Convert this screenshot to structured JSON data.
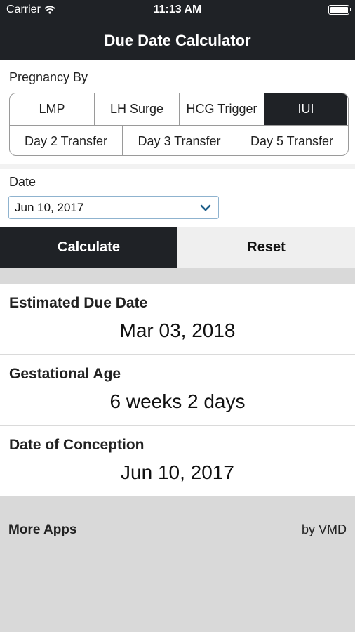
{
  "status_bar": {
    "carrier": "Carrier",
    "time": "11:13 AM"
  },
  "nav": {
    "title": "Due Date Calculator"
  },
  "pregnancy": {
    "label": "Pregnancy By",
    "row1": [
      "LMP",
      "LH Surge",
      "HCG Trigger",
      "IUI"
    ],
    "row2": [
      "Day 2 Transfer",
      "Day 3 Transfer",
      "Day 5 Transfer"
    ],
    "selected": "IUI"
  },
  "date": {
    "label": "Date",
    "value": "Jun 10, 2017"
  },
  "actions": {
    "calculate": "Calculate",
    "reset": "Reset"
  },
  "results": [
    {
      "title": "Estimated Due Date",
      "value": "Mar 03, 2018"
    },
    {
      "title": "Gestational Age",
      "value": "6 weeks 2 days"
    },
    {
      "title": "Date of Conception",
      "value": "Jun 10, 2017"
    }
  ],
  "footer": {
    "more_apps": "More Apps",
    "by": "by VMD"
  },
  "colors": {
    "dark": "#1f2226",
    "accent": "#1e5f8a",
    "background": "#d9d9d9"
  }
}
